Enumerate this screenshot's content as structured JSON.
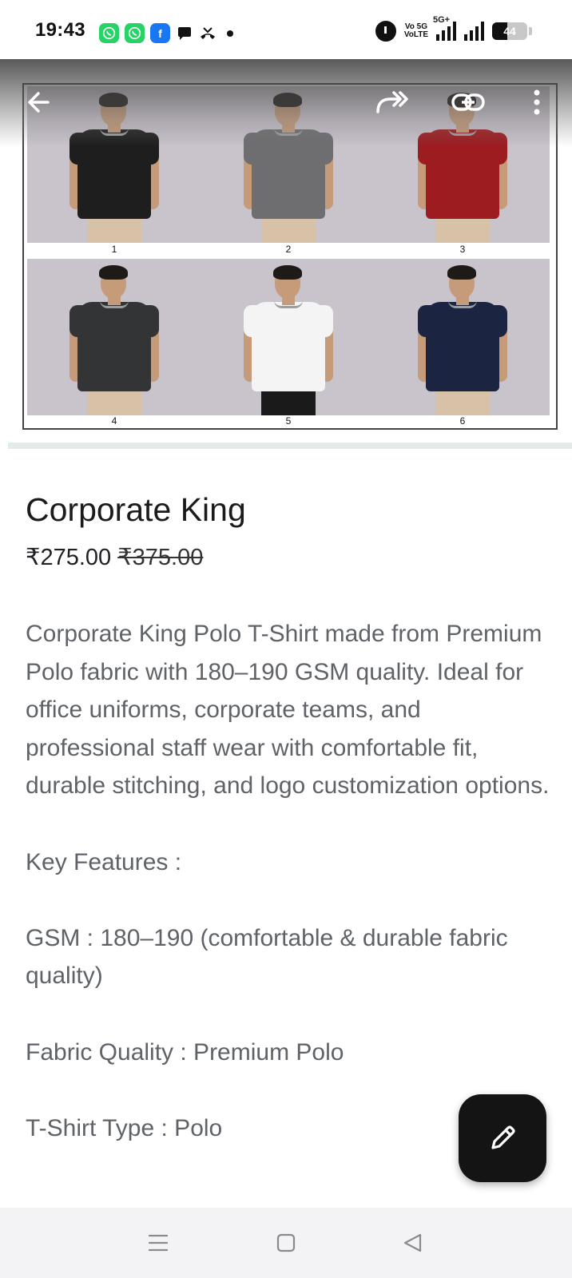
{
  "status_bar": {
    "time": "19:43",
    "notification_icons": [
      "whatsapp-icon",
      "whatsapp-business-icon",
      "facebook-icon",
      "message-icon",
      "missed-call-icon"
    ],
    "network_label_top": "Vo 5G",
    "network_label_bottom": "VoLTE",
    "network_type": "5G+",
    "battery_level": "44"
  },
  "media_viewer": {
    "tiles": [
      {
        "label": "1",
        "shirt_color": "#1e1e1e"
      },
      {
        "label": "2",
        "shirt_color": "#6e6e70"
      },
      {
        "label": "3",
        "shirt_color": "#9c1c20"
      },
      {
        "label": "4",
        "shirt_color": "#333436"
      },
      {
        "label": "5",
        "shirt_color": "#f4f4f4"
      },
      {
        "label": "6",
        "shirt_color": "#1b2440"
      }
    ],
    "actions": [
      "back-icon",
      "forward-icon",
      "link-icon",
      "more-icon"
    ]
  },
  "product": {
    "title": "Corporate King",
    "price": "₹275.00",
    "original_price": "₹375.00",
    "description": "Corporate King Polo T-Shirt made from Premium Polo fabric with 180–190 GSM quality. Ideal for office uniforms, corporate teams, and professional staff wear with comfortable fit, durable stitching, and logo customization options.",
    "features_heading": "Key Features :",
    "features": [
      "GSM : 180–190 (comfortable & durable fabric quality)",
      "Fabric Quality : Premium Polo",
      "T-Shirt Type : Polo"
    ]
  },
  "fab": {
    "icon": "pencil-icon"
  },
  "nav_bar": {
    "buttons": [
      "menu-icon",
      "home-icon",
      "back-icon"
    ]
  },
  "colors": {
    "accent_dark": "#141414",
    "text_primary": "#1b1b1b",
    "text_secondary": "#5f6368",
    "tile_background": "#c9c3cc"
  }
}
